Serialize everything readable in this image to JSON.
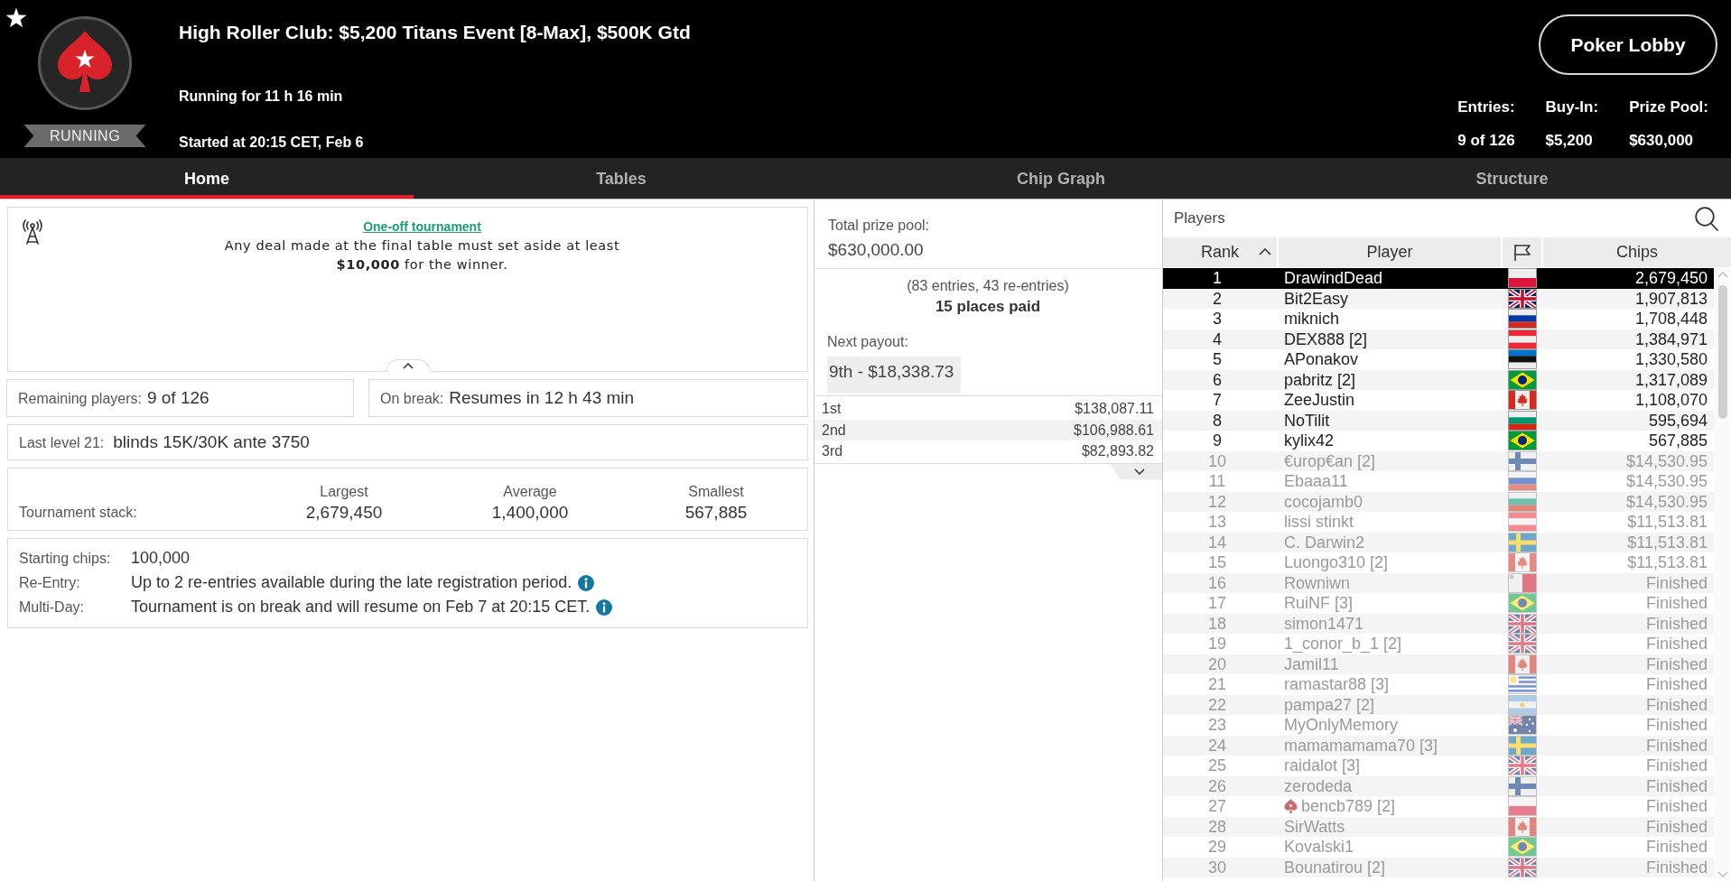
{
  "header": {
    "status": "RUNNING",
    "title": "High Roller Club: $5,200 Titans Event [8-Max], $500K Gtd",
    "running": "Running for 11 h 16 min",
    "started": "Started at 20:15 CET, Feb 6",
    "lobby_button": "Poker Lobby",
    "stats": [
      {
        "label": "Entries:",
        "value": "9 of 126"
      },
      {
        "label": "Buy-In:",
        "value": "$5,200"
      },
      {
        "label": "Prize Pool:",
        "value": "$630,000"
      }
    ]
  },
  "tabs": [
    {
      "label": "Home",
      "selected": true
    },
    {
      "label": "Tables",
      "selected": false
    },
    {
      "label": "Chip Graph",
      "selected": false
    },
    {
      "label": "Structure",
      "selected": false
    }
  ],
  "notice": {
    "link": "One-off tournament",
    "text": "Any deal made at the final table must set aside at least **$10,000** for the winner."
  },
  "status_rows": [
    {
      "label": "Remaining players:",
      "value": "9 of 126"
    },
    {
      "label": "On break:",
      "value": "Resumes in 12 h 43 min"
    }
  ],
  "last_level": {
    "label": "Last level 21:",
    "value": "blinds 15K/30K ante 3750"
  },
  "stack": {
    "label": "Tournament stack:",
    "columns": [
      {
        "heading": "Largest",
        "value": "2,679,450"
      },
      {
        "heading": "Average",
        "value": "1,400,000"
      },
      {
        "heading": "Smallest",
        "value": "567,885"
      }
    ]
  },
  "details": [
    {
      "label": "Starting chips:",
      "value": "100,000",
      "info": false
    },
    {
      "label": "Re-Entry:",
      "value": "Up to 2 re-entries available during the late registration period.",
      "info": true
    },
    {
      "label": "Multi-Day:",
      "value": "Tournament is on break and will resume on Feb 7 at 20:15 CET.",
      "info": true
    }
  ],
  "prize": {
    "label": "Total prize pool:",
    "value": "$630,000.00",
    "entries_note": "(83 entries, 43 re-entries)",
    "places_paid": "15 places paid",
    "next_label": "Next payout:",
    "next_value": "9th - $18,338.73",
    "payouts": [
      {
        "place": "1st",
        "amount": "$138,087.11"
      },
      {
        "place": "2nd",
        "amount": "$106,988.61"
      },
      {
        "place": "3rd",
        "amount": "$82,893.82"
      }
    ]
  },
  "players": {
    "title": "Players",
    "columns": [
      {
        "kind": "text",
        "label": "Rank",
        "sorted": true
      },
      {
        "kind": "text",
        "label": "Player",
        "sorted": false
      },
      {
        "kind": "flag",
        "sorted": false
      },
      {
        "kind": "text",
        "label": "Chips",
        "sorted": false
      }
    ],
    "rows": [
      {
        "rank": "1",
        "name": "DrawindDead",
        "flag": {
          "kind": "poland"
        },
        "chips": "2,679,450",
        "selected": true,
        "eliminated": false,
        "spade": false
      },
      {
        "rank": "2",
        "name": "Bit2Easy",
        "flag": {
          "kind": "uk"
        },
        "chips": "1,907,813",
        "selected": false,
        "eliminated": false,
        "spade": false
      },
      {
        "rank": "3",
        "name": "miknich",
        "flag": {
          "kind": "russia"
        },
        "chips": "1,708,448",
        "selected": false,
        "eliminated": false,
        "spade": false
      },
      {
        "rank": "4",
        "name": "DEX888 [2]",
        "flag": {
          "kind": "austria"
        },
        "chips": "1,384,971",
        "selected": false,
        "eliminated": false,
        "spade": false
      },
      {
        "rank": "5",
        "name": "APonakov",
        "flag": {
          "kind": "estonia"
        },
        "chips": "1,330,580",
        "selected": false,
        "eliminated": false,
        "spade": false
      },
      {
        "rank": "6",
        "name": "pabritz [2]",
        "flag": {
          "kind": "brazil"
        },
        "chips": "1,317,089",
        "selected": false,
        "eliminated": false,
        "spade": false
      },
      {
        "rank": "7",
        "name": "ZeeJustin",
        "flag": {
          "kind": "canada"
        },
        "chips": "1,108,070",
        "selected": false,
        "eliminated": false,
        "spade": false
      },
      {
        "rank": "8",
        "name": "NoTilit",
        "flag": {
          "kind": "bulgaria"
        },
        "chips": "595,694",
        "selected": false,
        "eliminated": false,
        "spade": false
      },
      {
        "rank": "9",
        "name": "kylix42",
        "flag": {
          "kind": "brazil"
        },
        "chips": "567,885",
        "selected": false,
        "eliminated": false,
        "spade": false
      },
      {
        "rank": "10",
        "name": "€urop€an [2]",
        "flag": {
          "kind": "finland"
        },
        "chips": "$14,530.95",
        "selected": false,
        "eliminated": true,
        "spade": false
      },
      {
        "rank": "11",
        "name": "Ebaaa11",
        "flag": {
          "kind": "russia"
        },
        "chips": "$14,530.95",
        "selected": false,
        "eliminated": true,
        "spade": false
      },
      {
        "rank": "12",
        "name": "cocojamb0",
        "flag": {
          "kind": "bulgaria"
        },
        "chips": "$14,530.95",
        "selected": false,
        "eliminated": true,
        "spade": false
      },
      {
        "rank": "13",
        "name": "lissi stinkt",
        "flag": {
          "kind": "austria"
        },
        "chips": "$11,513.81",
        "selected": false,
        "eliminated": true,
        "spade": false
      },
      {
        "rank": "14",
        "name": "C. Darwin2",
        "flag": {
          "kind": "sweden"
        },
        "chips": "$11,513.81",
        "selected": false,
        "eliminated": true,
        "spade": false
      },
      {
        "rank": "15",
        "name": "Luongo310 [2]",
        "flag": {
          "kind": "canada"
        },
        "chips": "$11,513.81",
        "selected": false,
        "eliminated": true,
        "spade": false
      },
      {
        "rank": "16",
        "name": "Rowniwn",
        "flag": {
          "kind": "malta"
        },
        "chips": "Finished",
        "selected": false,
        "eliminated": true,
        "spade": false
      },
      {
        "rank": "17",
        "name": "RuiNF [3]",
        "flag": {
          "kind": "brazil"
        },
        "chips": "Finished",
        "selected": false,
        "eliminated": true,
        "spade": false
      },
      {
        "rank": "18",
        "name": "simon1471",
        "flag": {
          "kind": "uk"
        },
        "chips": "Finished",
        "selected": false,
        "eliminated": true,
        "spade": false
      },
      {
        "rank": "19",
        "name": "1_conor_b_1 [2]",
        "flag": {
          "kind": "uk"
        },
        "chips": "Finished",
        "selected": false,
        "eliminated": true,
        "spade": false
      },
      {
        "rank": "20",
        "name": "Jamil11",
        "flag": {
          "kind": "canada"
        },
        "chips": "Finished",
        "selected": false,
        "eliminated": true,
        "spade": false
      },
      {
        "rank": "21",
        "name": "ramastar88 [3]",
        "flag": {
          "kind": "uruguay"
        },
        "chips": "Finished",
        "selected": false,
        "eliminated": true,
        "spade": false
      },
      {
        "rank": "22",
        "name": "pampa27 [2]",
        "flag": {
          "kind": "argentina"
        },
        "chips": "Finished",
        "selected": false,
        "eliminated": true,
        "spade": false
      },
      {
        "rank": "23",
        "name": "MyOnlyMemory",
        "flag": {
          "kind": "australia"
        },
        "chips": "Finished",
        "selected": false,
        "eliminated": true,
        "spade": false
      },
      {
        "rank": "24",
        "name": "mamamamama70 [3]",
        "flag": {
          "kind": "sweden"
        },
        "chips": "Finished",
        "selected": false,
        "eliminated": true,
        "spade": false
      },
      {
        "rank": "25",
        "name": "raidalot [3]",
        "flag": {
          "kind": "uk"
        },
        "chips": "Finished",
        "selected": false,
        "eliminated": true,
        "spade": false
      },
      {
        "rank": "26",
        "name": "zerodeda",
        "flag": {
          "kind": "finland"
        },
        "chips": "Finished",
        "selected": false,
        "eliminated": true,
        "spade": false
      },
      {
        "rank": "27",
        "name": "bencb789 [2]",
        "flag": {
          "kind": "poland"
        },
        "chips": "Finished",
        "selected": false,
        "eliminated": true,
        "spade": true
      },
      {
        "rank": "28",
        "name": "SirWatts",
        "flag": {
          "kind": "canada"
        },
        "chips": "Finished",
        "selected": false,
        "eliminated": true,
        "spade": false
      },
      {
        "rank": "29",
        "name": "Kovalski1",
        "flag": {
          "kind": "brazil"
        },
        "chips": "Finished",
        "selected": false,
        "eliminated": true,
        "spade": false
      },
      {
        "rank": "30",
        "name": "Bounatirou [2]",
        "flag": {
          "kind": "uk"
        },
        "chips": "Finished",
        "selected": false,
        "eliminated": true,
        "spade": false
      }
    ]
  }
}
